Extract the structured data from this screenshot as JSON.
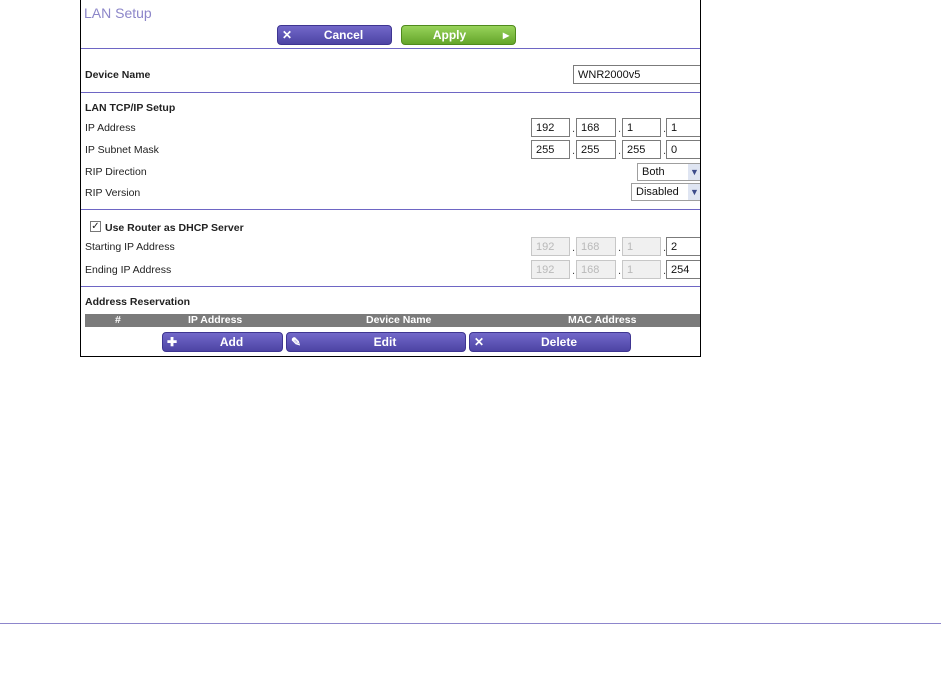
{
  "page": {
    "title": "LAN Setup"
  },
  "toolbar": {
    "cancel_label": "Cancel",
    "apply_label": "Apply"
  },
  "device": {
    "label": "Device Name",
    "value": "WNR2000v5"
  },
  "lan": {
    "section_title": "LAN TCP/IP Setup",
    "ip_label": "IP Address",
    "ip": [
      "192",
      "168",
      "1",
      "1"
    ],
    "mask_label": "IP Subnet Mask",
    "mask": [
      "255",
      "255",
      "255",
      "0"
    ],
    "rip_direction_label": "RIP Direction",
    "rip_direction_value": "Both",
    "rip_version_label": "RIP Version",
    "rip_version_value": "Disabled"
  },
  "dhcp": {
    "checkbox_label": "Use Router as DHCP Server",
    "checked": true,
    "start_label": "Starting IP Address",
    "start": [
      "192",
      "168",
      "1",
      "2"
    ],
    "end_label": "Ending IP Address",
    "end": [
      "192",
      "168",
      "1",
      "254"
    ]
  },
  "reservation": {
    "title": "Address Reservation",
    "columns": [
      "#",
      "IP Address",
      "Device Name",
      "MAC Address"
    ],
    "add_label": "Add",
    "edit_label": "Edit",
    "delete_label": "Delete"
  }
}
